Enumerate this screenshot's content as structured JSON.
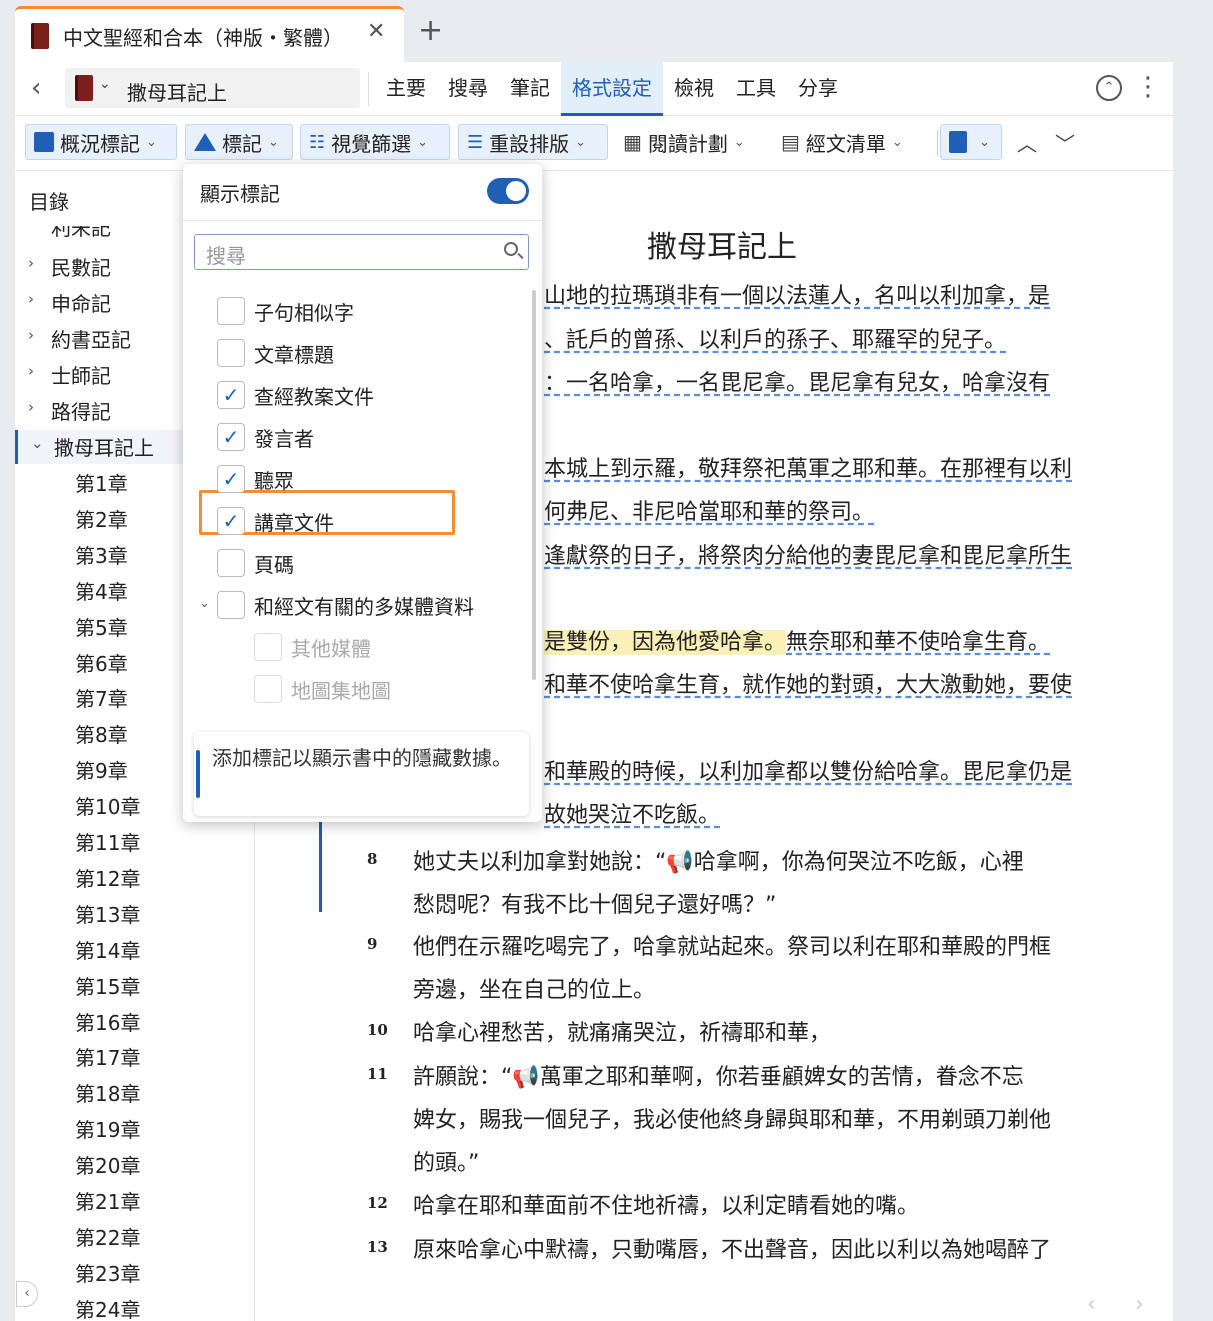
{
  "tab": {
    "title": "中文聖經和合本（神版・繁體）",
    "close_icon": "✕",
    "add_icon": "+"
  },
  "nav": {
    "back_icon": "‹",
    "book_selector": "撒母耳記上",
    "menu": [
      "主要",
      "搜尋",
      "筆記",
      "格式設定",
      "檢視",
      "工具",
      "分享"
    ],
    "active_menu": "格式設定"
  },
  "toolbar": {
    "buttons": [
      {
        "label": "概況標記",
        "icon": "checkbox-icon"
      },
      {
        "label": "標記",
        "icon": "triangle-icon"
      },
      {
        "label": "視覺篩選",
        "icon": "filter-icon"
      },
      {
        "label": "重設排版",
        "icon": "text-layout-icon"
      },
      {
        "label": "閱讀計劃",
        "icon": "calendar-icon"
      },
      {
        "label": "經文清單",
        "icon": "list-icon"
      }
    ]
  },
  "sidebar": {
    "title": "目錄",
    "partial_item": "利未記",
    "books": [
      "民數記",
      "申命記",
      "約書亞記",
      "士師記",
      "路得記"
    ],
    "current_book": "撒母耳記上",
    "chapters": [
      "第1章",
      "第2章",
      "第3章",
      "第4章",
      "第5章",
      "第6章",
      "第7章",
      "第8章",
      "第9章",
      "第10章",
      "第11章",
      "第12章",
      "第13章",
      "第14章",
      "第15章",
      "第16章",
      "第17章",
      "第18章",
      "第19章",
      "第20章",
      "第21章",
      "第22章",
      "第23章",
      "第24章"
    ]
  },
  "panel": {
    "header": "顯示標記",
    "toggle_on": true,
    "search_placeholder": "搜尋",
    "options": [
      {
        "label": "子句相似字",
        "checked": false
      },
      {
        "label": "文章標題",
        "checked": false
      },
      {
        "label": "查經教案文件",
        "checked": true
      },
      {
        "label": "發言者",
        "checked": true
      },
      {
        "label": "聽眾",
        "checked": true
      },
      {
        "label": "講章文件",
        "checked": true
      },
      {
        "label": "頁碼",
        "checked": false
      },
      {
        "label": "和經文有關的多媒體資料",
        "checked": false,
        "expandable": true
      }
    ],
    "sub_options": [
      {
        "label": "其他媒體",
        "checked": false,
        "disabled": true
      },
      {
        "label": "地圖集地圖",
        "checked": false,
        "disabled": true
      }
    ],
    "info": "添加標記以顯示書中的隱藏數據。"
  },
  "reading": {
    "title": "撒母耳記上",
    "fragments": [
      "山地的拉瑪瑣非有一個以法蓮人，名叫以利加拿，是",
      "、託戶的曾孫、以利戶的孫子、耶羅罕的兒子。",
      "：一名哈拿，一名毘尼拿。毘尼拿有兒女，哈拿沒有",
      "本城上到示羅，敬拜祭祀萬軍之耶和華。在那裡有以利",
      "何弗尼、非尼哈當耶和華的祭司。",
      "逢獻祭的日子，將祭肉分給他的妻毘尼拿和毘尼拿所生",
      "是雙份，因為他愛哈拿。",
      "無奈耶和華不使哈拿生育。",
      "和華不使哈拿生育，就作她的對頭，大大激動她，要使",
      "和華殿的時候，以利加拿都以雙份給哈拿。毘尼拿仍是",
      "故她哭泣不吃飯。"
    ],
    "verses": [
      {
        "num": "8",
        "lines": [
          "她丈夫以利加拿對她說：“📢哈拿啊，你為何哭泣不吃飯，心裡",
          "愁悶呢？有我不比十個兒子還好嗎？”"
        ]
      },
      {
        "num": "9",
        "lines": [
          "他們在示羅吃喝完了，哈拿就站起來。祭司以利在耶和華殿的門框",
          "旁邊，坐在自己的位上。"
        ]
      },
      {
        "num": "10",
        "lines": [
          "哈拿心裡愁苦，就痛痛哭泣，祈禱耶和華，"
        ]
      },
      {
        "num": "11",
        "lines": [
          "許願說：“📢萬軍之耶和華啊，你若垂顧婢女的苦情，眷念不忘",
          "婢女，賜我一個兒子，我必使他終身歸與耶和華，不用剃頭刀剃他",
          "的頭。”"
        ]
      },
      {
        "num": "12",
        "lines": [
          "哈拿在耶和華面前不住地祈禱，以利定睛看她的嘴。"
        ]
      },
      {
        "num": "13",
        "lines": [
          "原來哈拿心中默禱，只動嘴唇，不出聲音，因此以利以為她喝醉了"
        ]
      }
    ]
  },
  "colors": {
    "accent": "#1f5fb6",
    "tab_accent": "#f28c38",
    "highlight": "#fbf0b8",
    "book_icon": "#7a1f1a"
  }
}
